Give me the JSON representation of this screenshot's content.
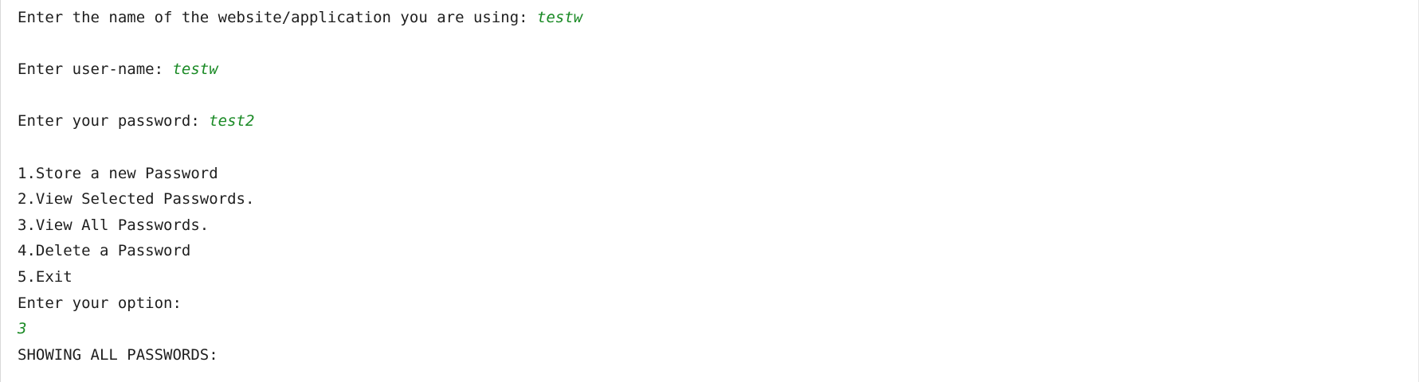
{
  "console": {
    "lines": [
      {
        "prompt": "Enter the name of the website/application you are using: ",
        "input": "testw"
      },
      {
        "prompt": "",
        "input": ""
      },
      {
        "prompt": "Enter user-name: ",
        "input": "testw"
      },
      {
        "prompt": "",
        "input": ""
      },
      {
        "prompt": "Enter your password: ",
        "input": "test2"
      },
      {
        "prompt": "",
        "input": ""
      },
      {
        "prompt": "1.Store a new Password",
        "input": ""
      },
      {
        "prompt": "2.View Selected Passwords.",
        "input": ""
      },
      {
        "prompt": "3.View All Passwords.",
        "input": ""
      },
      {
        "prompt": "4.Delete a Password",
        "input": ""
      },
      {
        "prompt": "5.Exit",
        "input": ""
      },
      {
        "prompt": "Enter your option:",
        "input": ""
      },
      {
        "prompt": "",
        "input": "3"
      },
      {
        "prompt": "SHOWING ALL PASSWORDS:",
        "input": ""
      }
    ]
  },
  "colors": {
    "output_text": "#1e1e1e",
    "user_input": "#1a8a25",
    "background": "#ffffff"
  }
}
